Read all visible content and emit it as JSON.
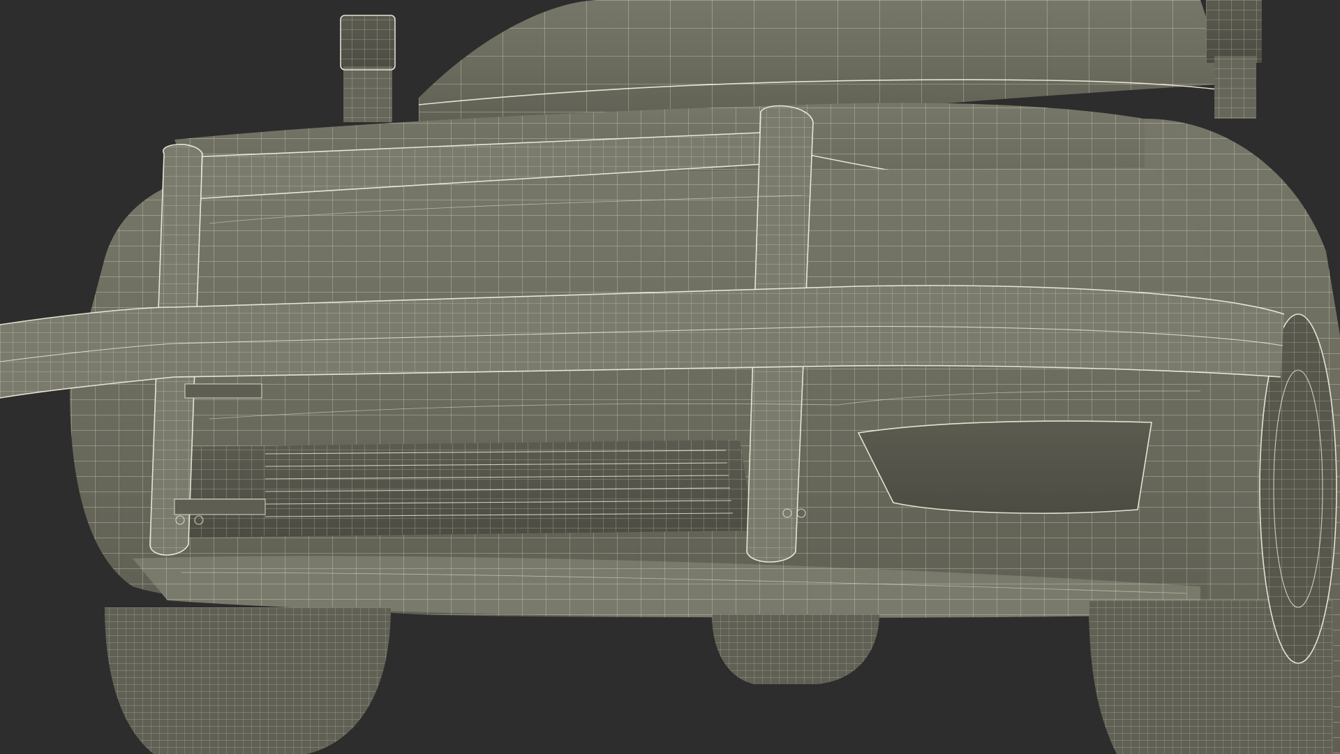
{
  "scene": {
    "subject": "",
    "background_color": "#2d2d2d",
    "surface_color": "#6d6d60",
    "surface_shadow_color": "#55554a",
    "wire_color": "#f1efdc"
  }
}
